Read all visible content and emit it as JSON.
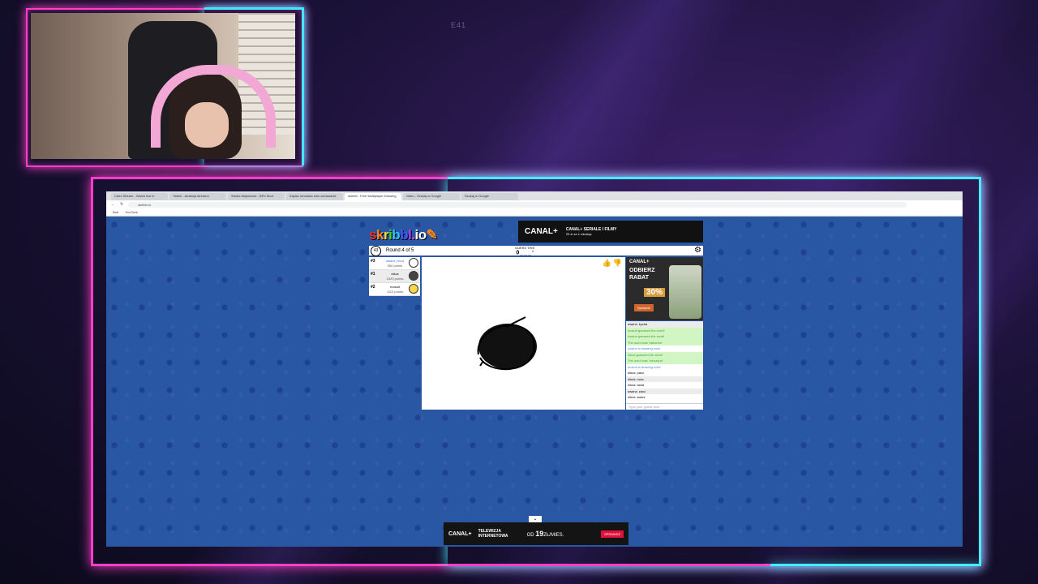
{
  "overlay": {
    "code": "E41"
  },
  "browser": {
    "tabs": [
      "Cami Stream - Watch live tv",
      "Twitch - Atrakcja streamu",
      "Studio Aktywność - BEV Mod",
      "Zapisz mnostwo dzis zamazanie",
      "skribbl - Free Multiplayer Drawing",
      "video - Szukaj w Google",
      "Szukaj w Google"
    ],
    "url": "skribbl.io",
    "bookmarks": [
      "Bob",
      "YouTube"
    ]
  },
  "game": {
    "logo": "skribbl.io",
    "timer": "43",
    "round": "Round 4 of 5",
    "guess_label": "GUESS THIS",
    "word_hint": "0___",
    "word_hint_count": "4",
    "players": [
      {
        "rank": "#3",
        "name": "owanz (You)",
        "points": "550 points"
      },
      {
        "rank": "#1",
        "name": "nikos",
        "points": "1520 points"
      },
      {
        "rank": "#2",
        "name": "mosuit",
        "points": "1110 points"
      }
    ],
    "chat": [
      {
        "text": "owanz: kycha",
        "style": "alt"
      },
      {
        "text": "mosuit guessed the word!",
        "style": "green"
      },
      {
        "text": "owanz guessed the word!",
        "style": "green"
      },
      {
        "text": "The word was 'kabanos'",
        "style": "green"
      },
      {
        "text": "owanz is drawing now!",
        "style": "blue"
      },
      {
        "text": "nikos guessed the word!",
        "style": "green"
      },
      {
        "text": "The word was 'muszyna'",
        "style": "green"
      },
      {
        "text": "mosuit is drawing now!",
        "style": "blue"
      },
      {
        "text": "nikos: pacz",
        "style": "plain"
      },
      {
        "text": "nikos: nora",
        "style": "alt"
      },
      {
        "text": "nikos: tacia",
        "style": "plain"
      },
      {
        "text": "owanz: zacz",
        "style": "alt"
      },
      {
        "text": "nikos: swiez",
        "style": "plain"
      }
    ],
    "chat_placeholder": "Type your guess here..."
  },
  "ads": {
    "top": {
      "brand": "CANAL+",
      "line1": "CANAL+ SERIALE I FILMY",
      "line2": "29 zł za 1 miesiąc"
    },
    "side": {
      "brand": "CANAL+",
      "headline": "ODBIERZ RABAT",
      "percent": "30%",
      "cta": "Sprawdź"
    },
    "bottom": {
      "brand": "CANAL+",
      "line1": "TELEWIZJA INTERNETOWA",
      "price_prefix": "OD",
      "price": "19",
      "price_suffix": "ZŁ/MIES.",
      "cta": "SPRAWDŹ"
    }
  },
  "colors": {
    "pink_neon": "#ff3fc8",
    "cyan_neon": "#42e8ff",
    "game_bg": "#2654a0"
  }
}
